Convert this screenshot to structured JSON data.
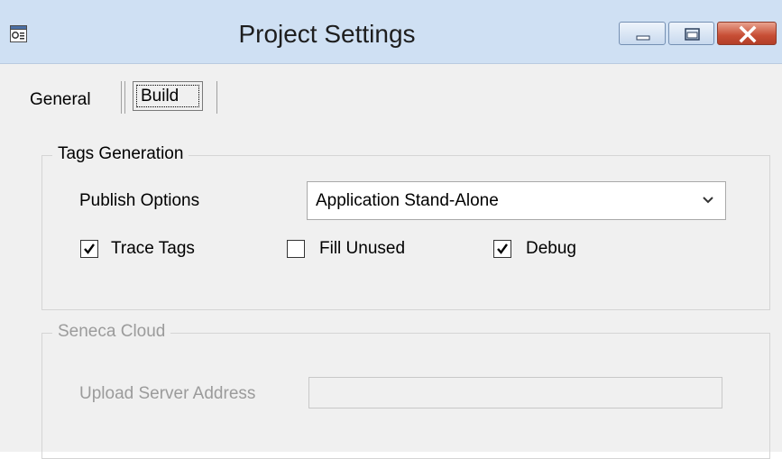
{
  "window": {
    "title": "Project Settings",
    "icon": "settings-window-icon",
    "controls": [
      "minimize-icon",
      "maximize-icon",
      "close-icon"
    ]
  },
  "tabs": [
    {
      "label": "General",
      "selected": false
    },
    {
      "label": "Build",
      "selected": true
    }
  ],
  "tags_generation": {
    "legend": "Tags Generation",
    "publish_options_label": "Publish Options",
    "publish_options_value": "Application Stand-Alone",
    "checkboxes": {
      "trace_tags": {
        "label": "Trace Tags",
        "checked": true
      },
      "fill_unused": {
        "label": "Fill Unused",
        "checked": false
      },
      "debug": {
        "label": "Debug",
        "checked": true
      }
    }
  },
  "seneca_cloud": {
    "legend": "Seneca Cloud",
    "upload_server_address_label": "Upload Server Address",
    "upload_server_address_value": "",
    "enabled": false
  },
  "colors": {
    "titlebar": "#cfe0f3",
    "close_button": "#c74e35",
    "disabled_text": "#9b9b9b"
  }
}
